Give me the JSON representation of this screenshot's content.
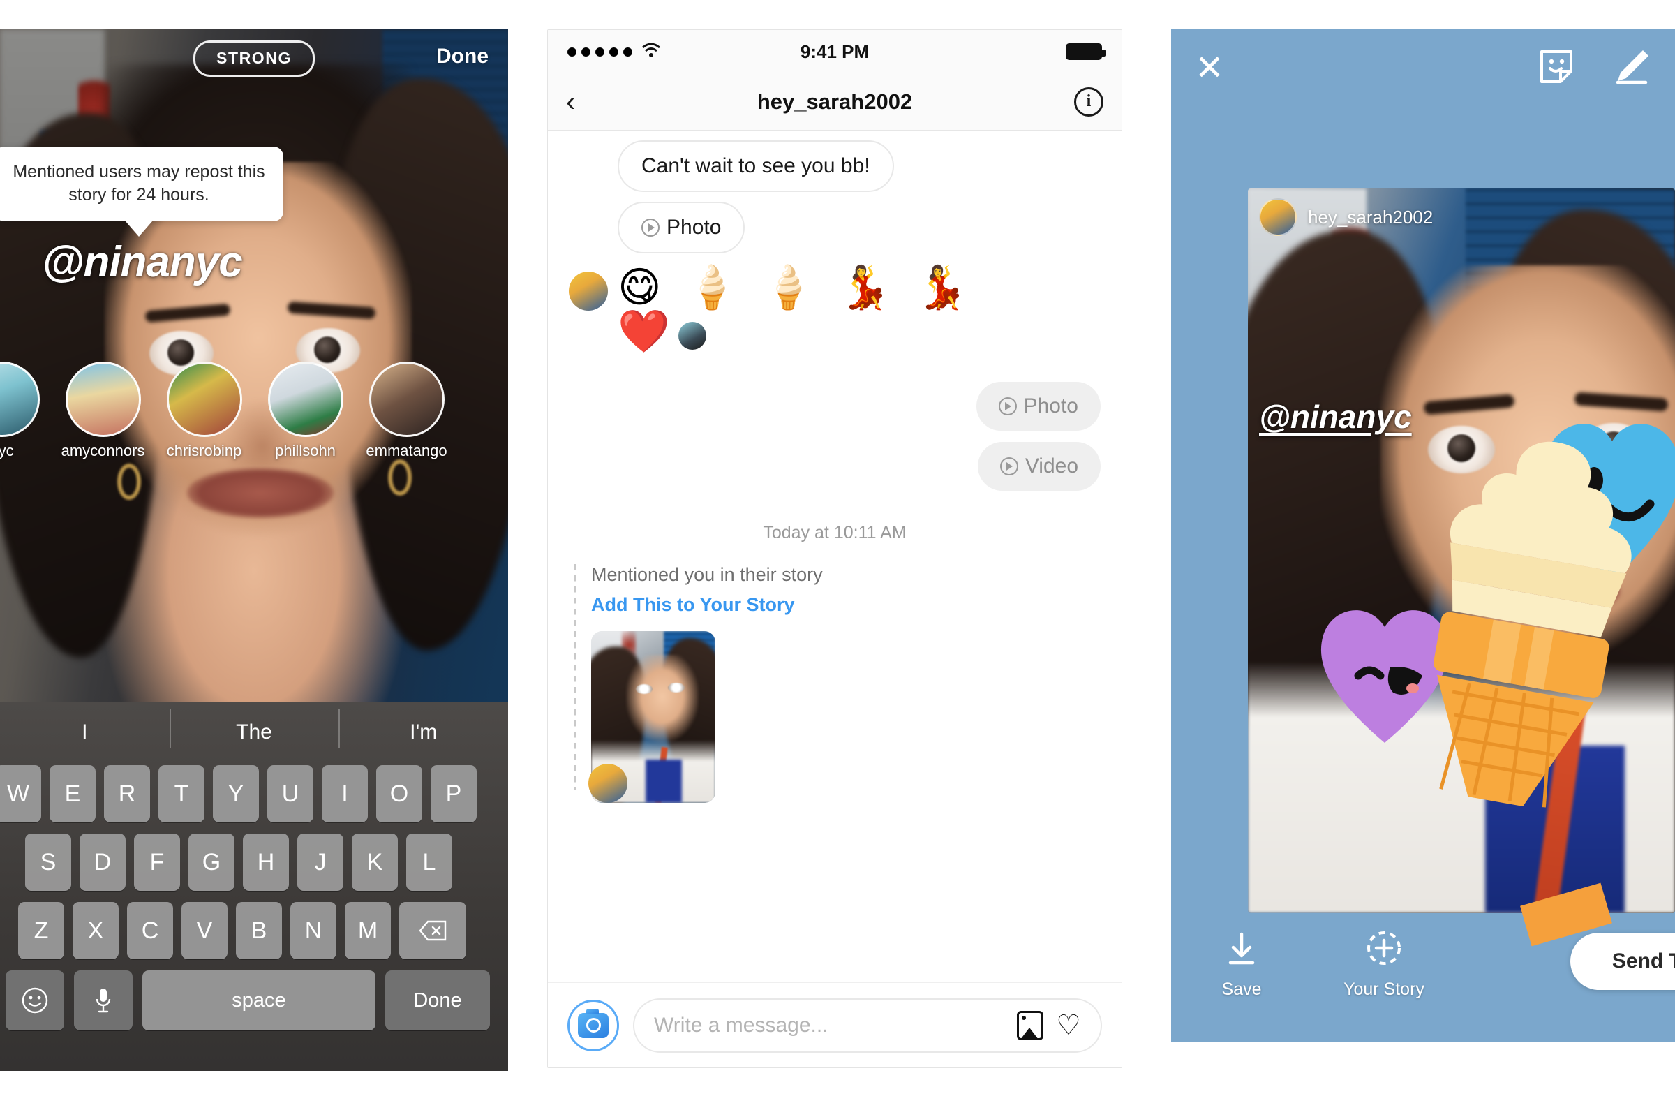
{
  "screens": [
    {
      "id": "story-mention-composer",
      "header": {
        "strength_badge": "STRONG",
        "done_label": "Done"
      },
      "tooltip": "Mentioned users may repost this story for 24 hours.",
      "mention_text": "@ninanyc",
      "suggestions": [
        {
          "username": "nyc"
        },
        {
          "username": "amyconnors"
        },
        {
          "username": "chrisrobinp"
        },
        {
          "username": "phillsohn"
        },
        {
          "username": "emmatango"
        }
      ],
      "keyboard": {
        "predictions": [
          "I",
          "The",
          "I'm"
        ],
        "row1": [
          "W",
          "E",
          "R",
          "T",
          "Y",
          "U",
          "I",
          "O",
          "P"
        ],
        "row2": [
          "S",
          "D",
          "F",
          "G",
          "H",
          "J",
          "K",
          "L"
        ],
        "row3": [
          "Z",
          "X",
          "C",
          "V",
          "B",
          "N",
          "M"
        ],
        "backspace_icon": "backspace-icon",
        "emoji_icon": "emoji-icon",
        "mic_icon": "microphone-icon",
        "space_label": "space",
        "done_label": "Done"
      }
    },
    {
      "id": "direct-message-thread",
      "status_bar": {
        "signal": "signal-dots-icon",
        "wifi": "wifi-icon",
        "time": "9:41 PM",
        "battery": "battery-full-icon"
      },
      "nav": {
        "back_icon": "chevron-left-icon",
        "title": "hey_sarah2002",
        "info_icon": "info-circle-icon"
      },
      "messages": [
        {
          "side": "incoming",
          "type": "text",
          "text": "Can't wait to see you bb!"
        },
        {
          "side": "incoming",
          "type": "media",
          "icon": "play-circle-icon",
          "text": "Photo"
        },
        {
          "side": "incoming",
          "type": "emoji",
          "line1": "😋 🍦 🍦 💃 💃",
          "line2": "❤️"
        },
        {
          "side": "outgoing",
          "type": "media",
          "icon": "play-circle-icon",
          "text": "Photo"
        },
        {
          "side": "outgoing",
          "type": "media",
          "icon": "play-circle-icon",
          "text": "Video"
        }
      ],
      "timestamp": "Today at 10:11 AM",
      "mention_card": {
        "label": "Mentioned you in their story",
        "action": "Add This to Your Story"
      },
      "composer": {
        "camera_icon": "camera-icon",
        "placeholder": "Write a message...",
        "photo_icon": "photo-library-icon",
        "heart_icon": "heart-icon"
      }
    },
    {
      "id": "story-repost-preview",
      "top_bar": {
        "close_icon": "close-icon",
        "sticker_icon": "sticker-icon",
        "draw_icon": "draw-pen-icon"
      },
      "story_card": {
        "avatar": "avatar",
        "username": "hey_sarah2002",
        "mention_text": "@ninanyc",
        "stickers": [
          "blue-heart-sticker",
          "purple-heart-sticker",
          "ice-cream-cone-sticker"
        ]
      },
      "bottom_bar": {
        "actions": [
          {
            "icon": "download-icon",
            "label": "Save"
          },
          {
            "icon": "add-to-story-icon",
            "label": "Your Story"
          }
        ],
        "send_to_label": "Send To"
      }
    }
  ],
  "colors": {
    "instagram_blue": "#3897f0",
    "story_backdrop": "#7ba7cc",
    "bubble_grey": "#efefef",
    "placeholder_grey": "#b4b4b4",
    "sticker_blue": "#4cb7e8",
    "sticker_purple": "#bd7fe0",
    "cone_orange": "#f5a03c",
    "ice_cream_cream": "#fbeec4"
  }
}
